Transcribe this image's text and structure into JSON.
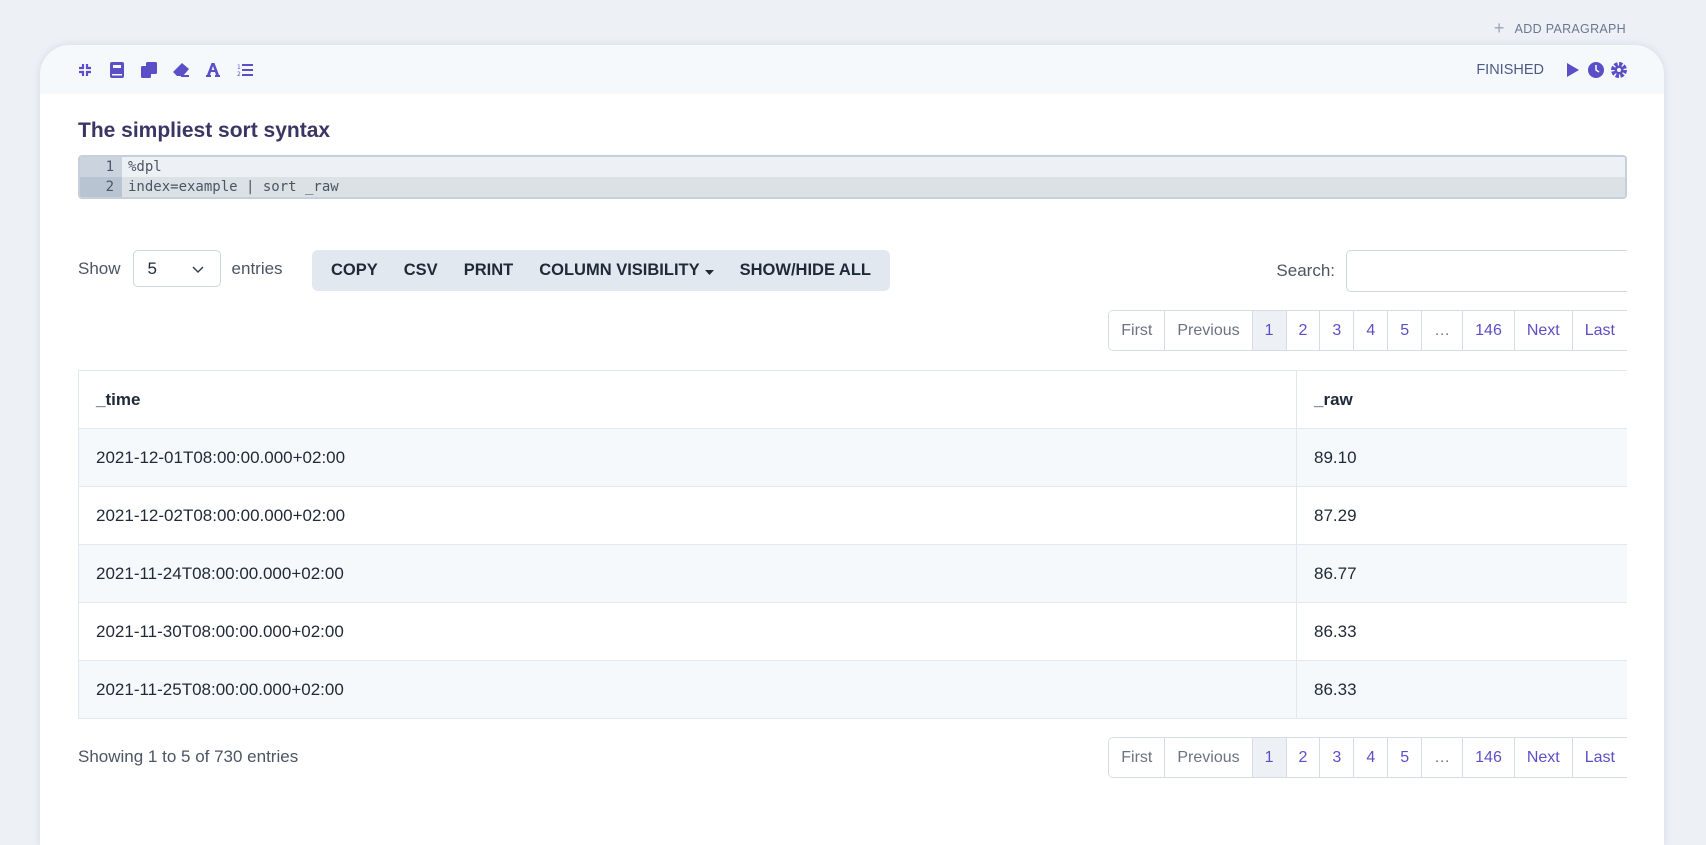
{
  "header": {
    "add_paragraph": "ADD PARAGRAPH"
  },
  "toolbar": {
    "icons": [
      "compress-icon",
      "book-icon",
      "copy-icon",
      "eraser-icon",
      "font-icon",
      "list-ol-icon"
    ],
    "status": "FINISHED",
    "accent": "#5b4fc7"
  },
  "paragraph": {
    "title": "The simpliest sort syntax",
    "code": [
      {
        "n": "1",
        "text": "%dpl"
      },
      {
        "n": "2",
        "text": "index=example | sort _raw"
      }
    ]
  },
  "controls": {
    "show_label": "Show",
    "entries_value": "5",
    "entries_label": "entries",
    "buttons": [
      "COPY",
      "CSV",
      "PRINT",
      "COLUMN VISIBILITY",
      "SHOW/HIDE ALL"
    ],
    "search_label": "Search:",
    "search_value": ""
  },
  "pagination": [
    "First",
    "Previous",
    "1",
    "2",
    "3",
    "4",
    "5",
    "…",
    "146",
    "Next",
    "Last"
  ],
  "table": {
    "columns": [
      "_time",
      "_raw"
    ],
    "rows": [
      [
        "2021-12-01T08:00:00.000+02:00",
        "89.10"
      ],
      [
        "2021-12-02T08:00:00.000+02:00",
        "87.29"
      ],
      [
        "2021-11-24T08:00:00.000+02:00",
        "86.77"
      ],
      [
        "2021-11-30T08:00:00.000+02:00",
        "86.33"
      ],
      [
        "2021-11-25T08:00:00.000+02:00",
        "86.33"
      ]
    ]
  },
  "footer": {
    "info": "Showing 1 to 5 of 730 entries"
  }
}
